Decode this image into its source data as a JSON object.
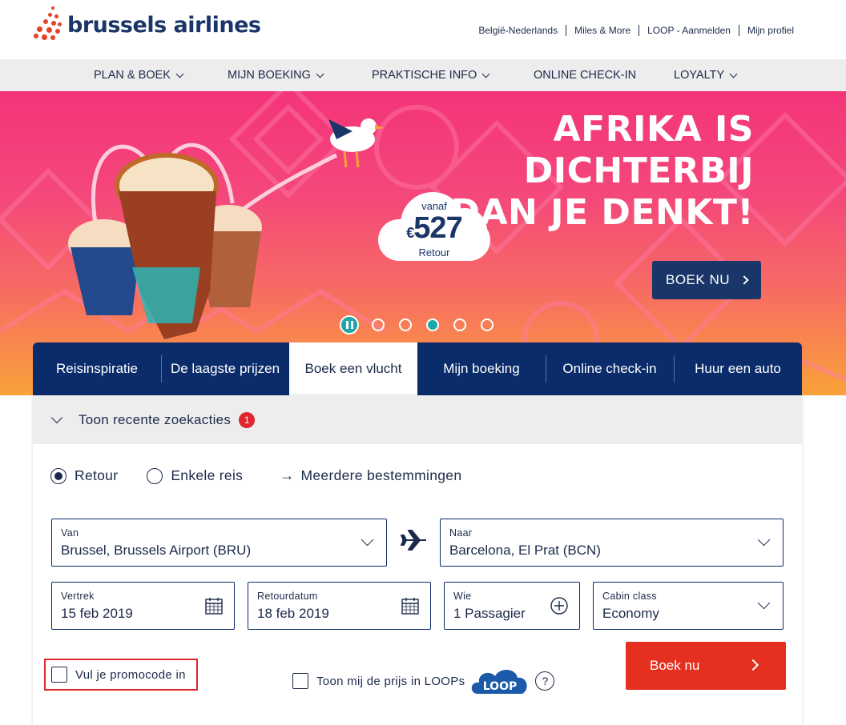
{
  "brand": {
    "name": "brussels airlines",
    "logo_color": "#e5412a",
    "text_color": "#1a3568"
  },
  "toplinks": [
    "België-Nederlands",
    "Miles & More",
    "LOOP - Aanmelden",
    "Mijn profiel"
  ],
  "nav": [
    {
      "label": "PLAN & BOEK",
      "dropdown": true
    },
    {
      "label": "MIJN BOEKING",
      "dropdown": true
    },
    {
      "label": "PRAKTISCHE INFO",
      "dropdown": true
    },
    {
      "label": "ONLINE CHECK-IN",
      "dropdown": false
    },
    {
      "label": "LOYALTY",
      "dropdown": true
    }
  ],
  "hero": {
    "title_lines": [
      "AFRIKA IS",
      "DICHTERBIJ",
      "DAN JE DENKT!"
    ],
    "price_from": "vanaf",
    "price_currency": "€",
    "price_value": "527",
    "price_sub": "Retour",
    "cta": "BOEK NU",
    "carousel": {
      "slides": 5,
      "active": 3,
      "paused": true
    }
  },
  "tabs": [
    {
      "label": "Reisinspiratie"
    },
    {
      "label": "De laagste prijzen"
    },
    {
      "label": "Boek een vlucht",
      "active": true
    },
    {
      "label": "Mijn boeking"
    },
    {
      "label": "Online check-in"
    },
    {
      "label": "Huur een auto"
    }
  ],
  "recent": {
    "label": "Toon recente zoekacties",
    "count": "1"
  },
  "trip": {
    "retour": "Retour",
    "oneway": "Enkele reis",
    "multi": "Meerdere bestemmingen",
    "selected": "retour"
  },
  "from": {
    "label": "Van",
    "value": "Brussel, Brussels Airport (BRU)"
  },
  "to": {
    "label": "Naar",
    "value": "Barcelona, El Prat (BCN)"
  },
  "depart": {
    "label": "Vertrek",
    "value": "15 feb 2019"
  },
  "return": {
    "label": "Retourdatum",
    "value": "18 feb 2019"
  },
  "pax": {
    "label": "Wie",
    "value": "1 Passagier"
  },
  "cabin": {
    "label": "Cabin class",
    "value": "Economy"
  },
  "promo": {
    "label": "Vul je promocode in"
  },
  "loops": {
    "label": "Toon mij de prijs in LOOPs",
    "logo": "LOOP",
    "help": "?"
  },
  "submit": {
    "label": "Boek nu"
  },
  "colors": {
    "navy": "#0b2c6b",
    "red": "#e5301f",
    "teal": "#1fa7a8",
    "pink": "#f4347a",
    "orange": "#f9a23a"
  }
}
